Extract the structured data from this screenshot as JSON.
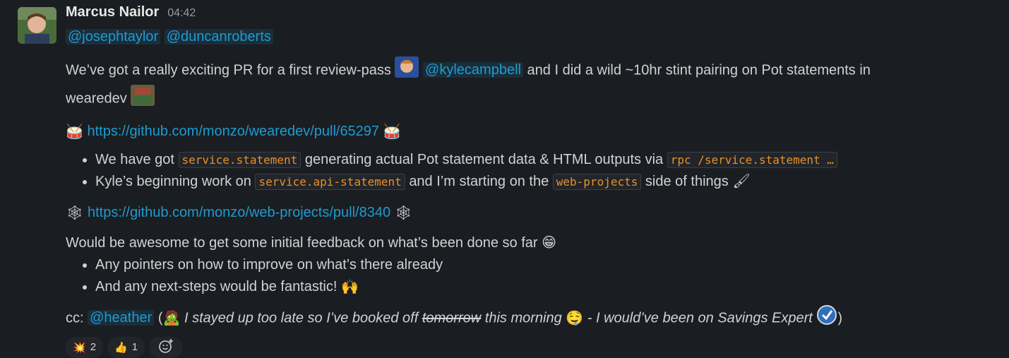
{
  "message": {
    "author": "Marcus Nailor",
    "time": "04:42",
    "mentions_top": [
      "@josephtaylor",
      "@duncanroberts"
    ],
    "para1": {
      "a": "We’ve got a really exciting PR for a first review-pass",
      "mention": "@kylecampbell",
      "b": "and I did a wild ~10hr stint pairing on Pot statements in",
      "c": "wearedev"
    },
    "link1": "https://github.com/monzo/wearedev/pull/65297",
    "bullets1": [
      {
        "a": "We have got",
        "code1": "service.statement",
        "b": "generating actual Pot statement data & HTML outputs via",
        "code2": "rpc /service.statement …"
      },
      {
        "a": "Kyle’s beginning work on",
        "code1": "service.api-statement",
        "b": "and I’m starting on the",
        "code2": "web-projects",
        "c": "side of things"
      }
    ],
    "link2": "https://github.com/monzo/web-projects/pull/8340",
    "para2": "Would be awesome to get some initial feedback on what’s been done so far",
    "bullets2": [
      "Any pointers on how to improve on what’s there already",
      "And any next-steps would be fantastic!"
    ],
    "cc": {
      "prefix": "cc:",
      "mention": "@heather",
      "open": "(",
      "italic_a": "I stayed up too late so I’ve booked off",
      "strike": "tomorrow",
      "italic_b": "this morning",
      "italic_c": "- I would’ve been on Savings Expert",
      "close": ")"
    }
  },
  "reactions": [
    {
      "icon": "collision-icon",
      "count": "2"
    },
    {
      "icon": "thumbs-up-icon",
      "count": "1"
    }
  ]
}
